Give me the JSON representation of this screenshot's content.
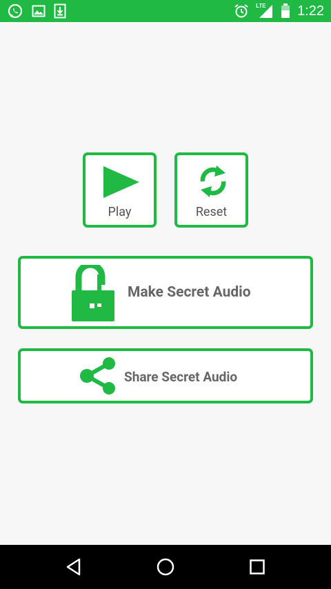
{
  "status_bar": {
    "time": "1:22",
    "network_label": "LTE",
    "left_icons": [
      "whatsapp-icon",
      "image-icon",
      "download-icon"
    ],
    "right_icons": [
      "alarm-icon",
      "signal-icon",
      "battery-icon"
    ],
    "background_color": "#1fb944"
  },
  "controls": {
    "play_label": "Play",
    "reset_label": "Reset",
    "make_label": "Make Secret Audio",
    "share_label": "Share Secret Audio",
    "accent_color": "#1fb944"
  },
  "nav_bar": {
    "icons": [
      "back-icon",
      "home-icon",
      "recents-icon"
    ]
  }
}
